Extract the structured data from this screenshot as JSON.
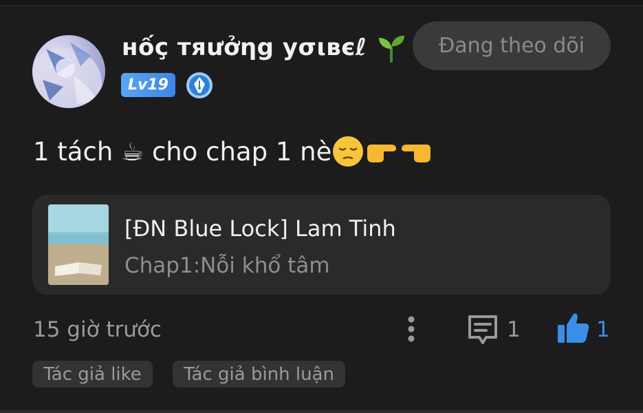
{
  "comment": {
    "user": {
      "name": "нốç тяưởηg уσιвєℓ",
      "level": "Lv19",
      "follow_label": "Đang theo dõi"
    },
    "text": "1 tách ☕ cho chap 1 nè",
    "emojis": [
      "pensive-face",
      "pointing-right",
      "pointing-left"
    ],
    "story": {
      "title": "[ĐN Blue Lock] Lam Tinh",
      "chapter": "Chap1:Nỗi khổ tâm"
    },
    "timestamp": "15 giờ trước",
    "reply_count": "1",
    "like_count": "1",
    "tags": [
      "Tác giả like",
      "Tác giả bình luận"
    ]
  },
  "colors": {
    "background": "#1c1c1d",
    "card": "#2a2a2b",
    "accent_blue": "#3a8ee6",
    "muted_text": "#9a9a9b"
  }
}
